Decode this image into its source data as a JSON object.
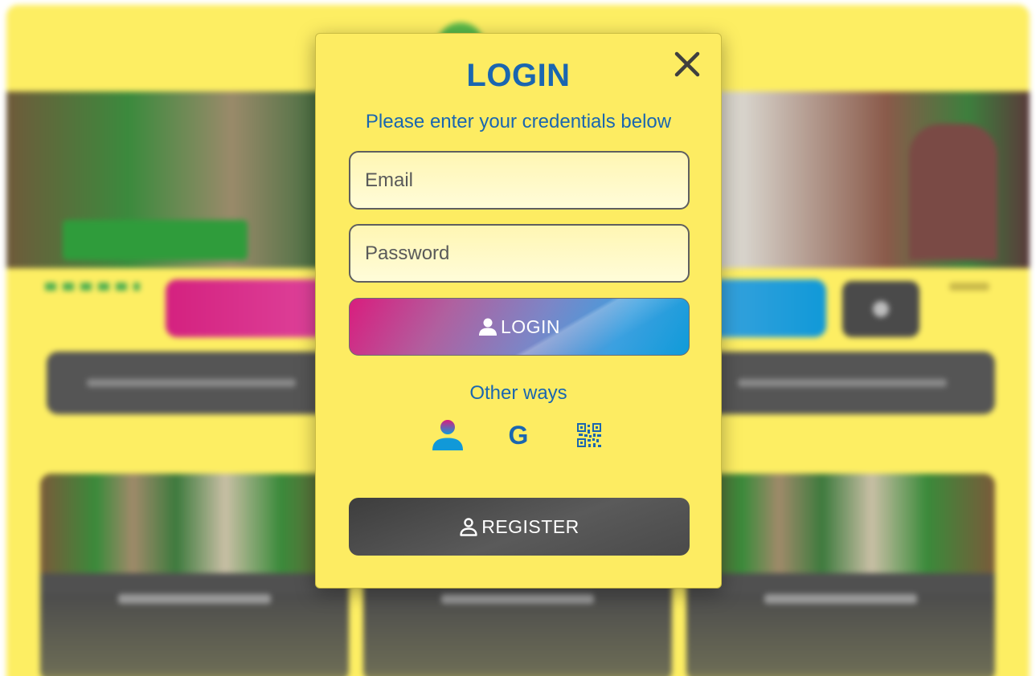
{
  "modal": {
    "title": "LOGIN",
    "subtitle": "Please enter your credentials below",
    "email_placeholder": "Email",
    "password_placeholder": "Password",
    "login_label": "LOGIN",
    "other_ways_label": "Other ways",
    "google_letter": "G",
    "register_label": "REGISTER"
  },
  "icons": {
    "close": "close-icon",
    "login": "user-icon",
    "register": "user-outline-icon",
    "alt_user": "user-icon",
    "alt_google": "google-icon",
    "alt_qr": "qr-code-icon"
  },
  "colors": {
    "modal_bg": "#fdec62",
    "accent_blue": "#1a66b0",
    "gradient_pink": "#d91d7e",
    "gradient_blue": "#0f9bd9",
    "register_bg": "#4a4a4a"
  }
}
